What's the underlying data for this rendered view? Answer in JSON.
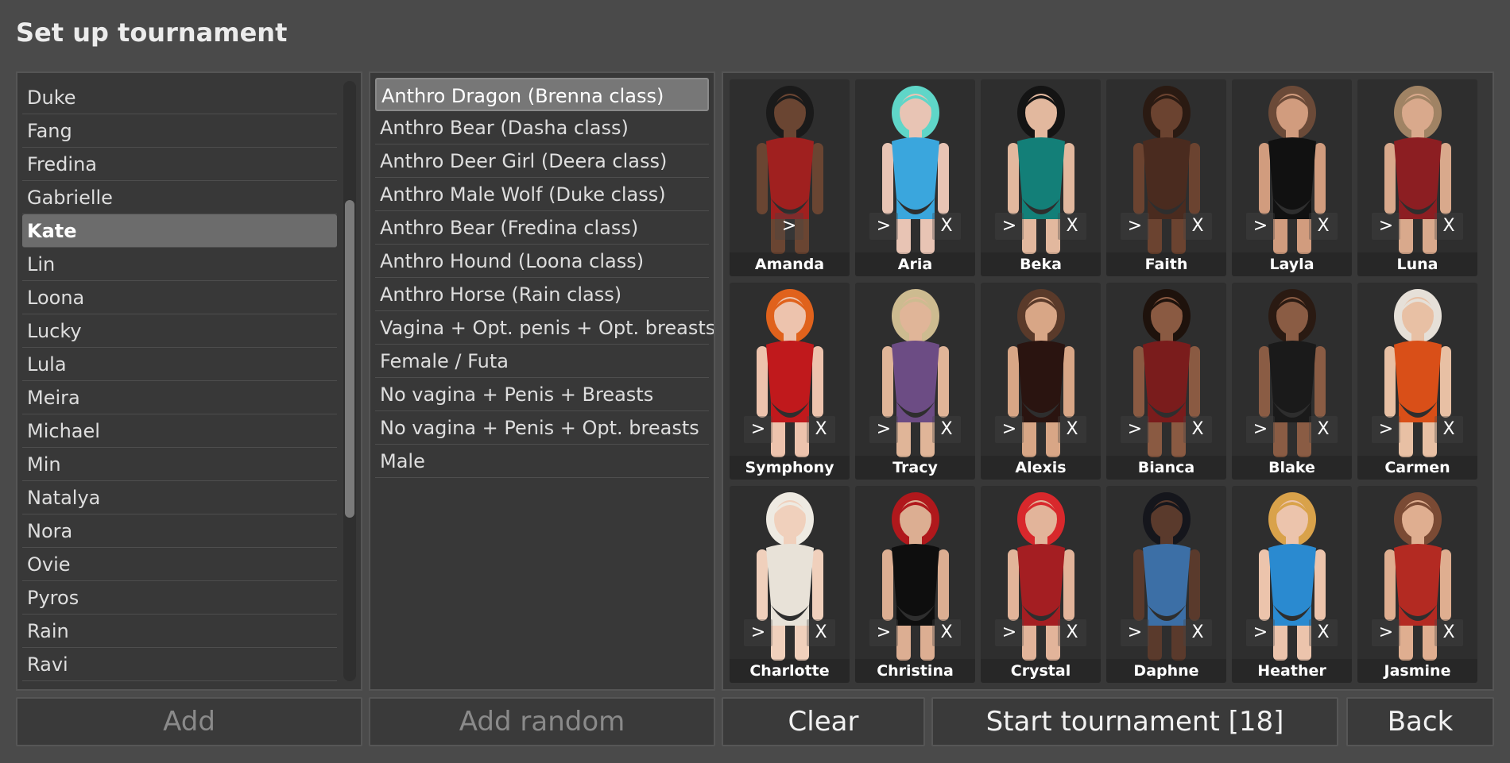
{
  "page": {
    "title": "Set up tournament"
  },
  "roster": {
    "items": [
      "Duke",
      "Fang",
      "Fredina",
      "Gabrielle",
      "Kate",
      "Lin",
      "Loona",
      "Lucky",
      "Lula",
      "Meira",
      "Michael",
      "Min",
      "Natalya",
      "Nora",
      "Ovie",
      "Pyros",
      "Rain",
      "Ravi"
    ],
    "selected": "Kate"
  },
  "classes": {
    "items": [
      "Anthro Dragon (Brenna class)",
      "Anthro Bear (Dasha class)",
      "Anthro Deer Girl (Deera class)",
      "Anthro Male Wolf (Duke class)",
      "Anthro Bear (Fredina class)",
      "Anthro Hound (Loona class)",
      "Anthro Horse (Rain class)",
      "Vagina + Opt. penis + Opt. breasts",
      "Female / Futa",
      "No vagina + Penis + Breasts",
      "No vagina + Penis + Opt. breasts",
      "Male"
    ],
    "selected": "Anthro Dragon (Brenna class)"
  },
  "participants": [
    {
      "name": "Amanda",
      "hair": "#1a1a1a",
      "skin": "#6a4532",
      "outfit": "#a0201f",
      "first": true
    },
    {
      "name": "Aria",
      "hair": "#5fd6c8",
      "skin": "#e8c4b4",
      "outfit": "#3aa6dd"
    },
    {
      "name": "Beka",
      "hair": "#141414",
      "skin": "#e2b89e",
      "outfit": "#137f78"
    },
    {
      "name": "Faith",
      "hair": "#2a1a12",
      "skin": "#6b4330",
      "outfit": "#4a2b1f"
    },
    {
      "name": "Layla",
      "hair": "#6b4a38",
      "skin": "#d19c7e",
      "outfit": "#111111"
    },
    {
      "name": "Luna",
      "hair": "#a08364",
      "skin": "#d9a98c",
      "outfit": "#8c1e22"
    },
    {
      "name": "Symphony",
      "hair": "#e0621c",
      "skin": "#edc3ad",
      "outfit": "#c0191c"
    },
    {
      "name": "Tracy",
      "hair": "#cdbb90",
      "skin": "#e0b598",
      "outfit": "#6c4c84"
    },
    {
      "name": "Alexis",
      "hair": "#5a3a2a",
      "skin": "#d8a686",
      "outfit": "#2a1410"
    },
    {
      "name": "Bianca",
      "hair": "#1e120c",
      "skin": "#8a5a42",
      "outfit": "#7a1c1c"
    },
    {
      "name": "Blake",
      "hair": "#2a1a12",
      "skin": "#8a5c44",
      "outfit": "#1a1a1a"
    },
    {
      "name": "Carmen",
      "hair": "#e6e0d8",
      "skin": "#e8c0a4",
      "outfit": "#d94f18"
    },
    {
      "name": "Charlotte",
      "hair": "#eeeae2",
      "skin": "#f0d0bc",
      "outfit": "#e8e2d8"
    },
    {
      "name": "Christina",
      "hair": "#b0181c",
      "skin": "#dcae92",
      "outfit": "#0e0e0e"
    },
    {
      "name": "Crystal",
      "hair": "#d8282c",
      "skin": "#e2b49a",
      "outfit": "#a41e22"
    },
    {
      "name": "Daphne",
      "hair": "#15161c",
      "skin": "#5a3a2c",
      "outfit": "#3c6fa6"
    },
    {
      "name": "Heather",
      "hair": "#d9a24a",
      "skin": "#ecc4ac",
      "outfit": "#2a8ad0"
    },
    {
      "name": "Jasmine",
      "hair": "#7a4a34",
      "skin": "#dfae90",
      "outfit": "#b32a22"
    }
  ],
  "controls": {
    "move": ">",
    "remove": "X"
  },
  "buttons": {
    "add": "Add",
    "add_random": "Add random",
    "clear": "Clear",
    "start": "Start tournament [18]",
    "back": "Back"
  }
}
